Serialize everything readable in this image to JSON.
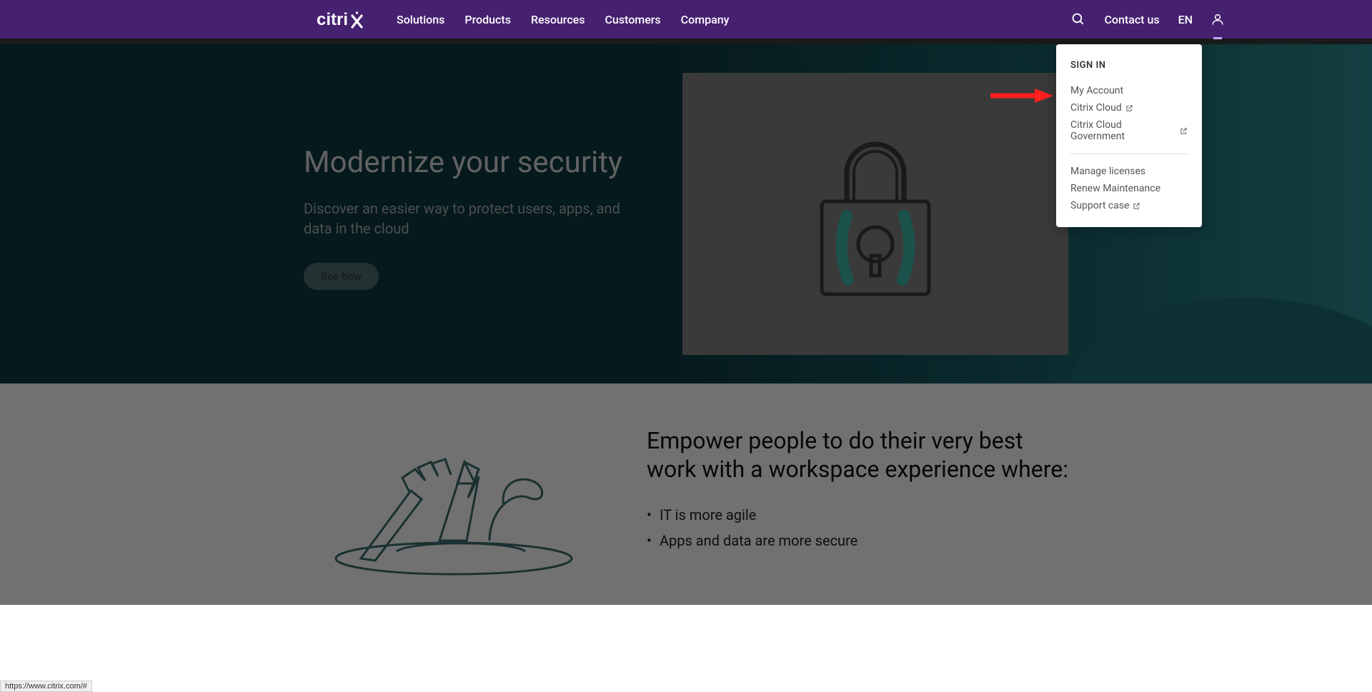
{
  "nav": {
    "brand": "citrix",
    "links": [
      "Solutions",
      "Products",
      "Resources",
      "Customers",
      "Company"
    ],
    "contact": "Contact us",
    "lang": "EN"
  },
  "dropdown": {
    "title": "SIGN IN",
    "group1": [
      {
        "label": "My Account",
        "external": false
      },
      {
        "label": "Citrix Cloud",
        "external": true
      },
      {
        "label": "Citrix Cloud Government",
        "external": true
      }
    ],
    "group2": [
      {
        "label": "Manage licenses",
        "external": false
      },
      {
        "label": "Renew Maintenance",
        "external": false
      },
      {
        "label": "Support case",
        "external": true
      }
    ]
  },
  "hero": {
    "title": "Modernize your security",
    "subtitle": "Discover an easier way to protect users, apps, and data in the cloud",
    "cta": "See how"
  },
  "section2": {
    "title": "Empower people to do their very best work with a workspace experience where:",
    "bullets": [
      "IT is more agile",
      "Apps and data are more secure"
    ]
  },
  "status_url": "https://www.citrix.com/#"
}
